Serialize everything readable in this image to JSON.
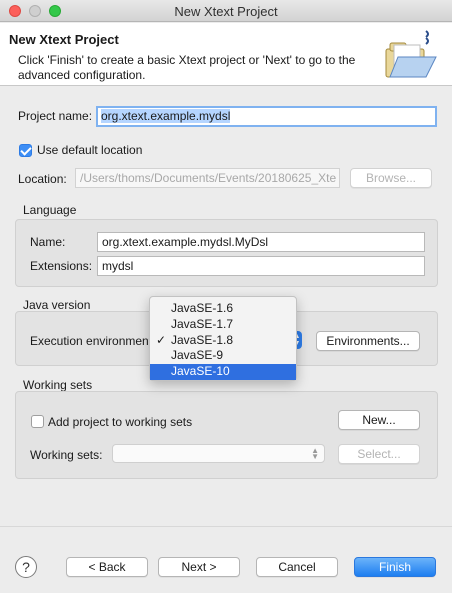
{
  "window": {
    "title": "New Xtext Project"
  },
  "header": {
    "title": "New Xtext Project",
    "description": "Click 'Finish' to create a basic Xtext project or 'Next' to go to the advanced configuration."
  },
  "project": {
    "name_label": "Project name:",
    "name_value": "org.xtext.example.mydsl",
    "use_default_label": "Use default location",
    "use_default_checked": true,
    "location_label": "Location:",
    "location_value": "/Users/thoms/Documents/Events/20180625_Xte",
    "browse_label": "Browse..."
  },
  "language": {
    "group_label": "Language",
    "name_label": "Name:",
    "name_value": "org.xtext.example.mydsl.MyDsl",
    "extensions_label": "Extensions:",
    "extensions_value": "mydsl"
  },
  "java": {
    "group_label": "Java version",
    "exec_label": "Execution environment",
    "environments_label": "Environments...",
    "options": [
      "JavaSE-1.6",
      "JavaSE-1.7",
      "JavaSE-1.8",
      "JavaSE-9",
      "JavaSE-10"
    ],
    "checked_option": "JavaSE-1.8",
    "highlighted_option": "JavaSE-10",
    "check_mark": "✓"
  },
  "working_sets": {
    "group_label": "Working sets",
    "add_label": "Add project to working sets",
    "add_checked": false,
    "new_label": "New...",
    "sets_label": "Working sets:",
    "select_label": "Select..."
  },
  "footer": {
    "help_label": "?",
    "back_label": "< Back",
    "next_label": "Next >",
    "cancel_label": "Cancel",
    "finish_label": "Finish"
  },
  "colors": {
    "accent": "#2f6fe0",
    "primary_button": "#1d7ef0",
    "close": "#fc605b",
    "maximize": "#34c84a"
  }
}
